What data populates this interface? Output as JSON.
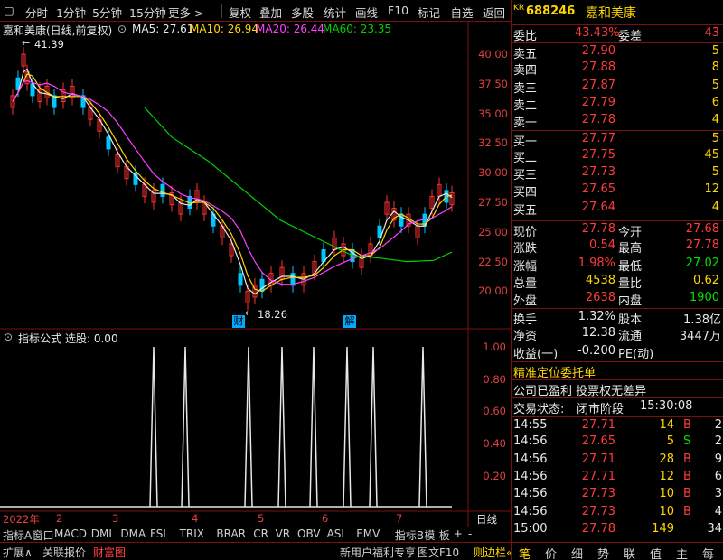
{
  "toolbar": {
    "items": [
      "分时",
      "1分钟",
      "5分钟",
      "15分钟",
      "更多 >",
      "复权",
      "叠加",
      "多股",
      "统计",
      "画线",
      "F10",
      "标记",
      "-自选",
      "返回"
    ]
  },
  "chart": {
    "title": "嘉和美康(日线,前复权)",
    "ma": [
      {
        "label": "MA5: 27.61",
        "color": "#e8e8e8"
      },
      {
        "label": "MA10: 26.94",
        "color": "#ffd700"
      },
      {
        "label": "MA20: 26.44",
        "color": "#ff40ff"
      },
      {
        "label": "MA60: 23.35",
        "color": "#00d000"
      }
    ],
    "y_ticks": [
      "40.00",
      "37.50",
      "35.00",
      "32.50",
      "30.00",
      "27.50",
      "25.00",
      "22.50",
      "20.00"
    ],
    "high_label": "41.39",
    "low_label": "18.26",
    "marker_cai": "财",
    "marker_jie": "解",
    "colors": {
      "up": "#ff3030",
      "down": "#00c8ff",
      "axis": "#7a1010"
    }
  },
  "indicator": {
    "title": "指标公式",
    "sub": "选股: 0.00",
    "y_ticks": [
      "1.00",
      "0.80",
      "0.60",
      "0.40",
      "0.20"
    ]
  },
  "time_axis": {
    "labels": [
      "2022年",
      "2",
      "3",
      "4",
      "5",
      "6",
      "7"
    ],
    "right": "日线"
  },
  "tabs1": [
    "指标A",
    "窗口",
    "MACD",
    "DMI",
    "DMA",
    "FSL",
    "TRIX",
    "BRAR",
    "CR",
    "VR",
    "OBV",
    "ASI",
    "EMV",
    "指标B",
    "模",
    "板",
    "+",
    "-"
  ],
  "tabs2": {
    "left": [
      "扩展∧",
      "关联报价",
      "财富图"
    ],
    "right": [
      "新用户福利专享",
      "图文F10",
      "则边栏«"
    ]
  },
  "quote": {
    "badge": "KR",
    "code": "688246",
    "name": "嘉和美康",
    "weibi_label": "委比",
    "weibi": "43.43%",
    "weicha_label": "委差",
    "weicha": "43",
    "asks": [
      {
        "label": "卖五",
        "price": "27.90",
        "vol": "5"
      },
      {
        "label": "卖四",
        "price": "27.88",
        "vol": "8"
      },
      {
        "label": "卖三",
        "price": "27.87",
        "vol": "5"
      },
      {
        "label": "卖二",
        "price": "27.79",
        "vol": "6"
      },
      {
        "label": "卖一",
        "price": "27.78",
        "vol": "4"
      }
    ],
    "bids": [
      {
        "label": "买一",
        "price": "27.77",
        "vol": "5"
      },
      {
        "label": "买二",
        "price": "27.75",
        "vol": "45"
      },
      {
        "label": "买三",
        "price": "27.73",
        "vol": "5"
      },
      {
        "label": "买四",
        "price": "27.65",
        "vol": "12"
      },
      {
        "label": "买五",
        "price": "27.64",
        "vol": "4"
      }
    ],
    "stats": [
      {
        "l1": "现价",
        "v1": "27.78",
        "c1": "red",
        "l2": "今开",
        "v2": "27.68",
        "c2": "red"
      },
      {
        "l1": "涨跌",
        "v1": "0.54",
        "c1": "red",
        "l2": "最高",
        "v2": "27.78",
        "c2": "red"
      },
      {
        "l1": "涨幅",
        "v1": "1.98%",
        "c1": "red",
        "l2": "最低",
        "v2": "27.02",
        "c2": "grn"
      },
      {
        "l1": "总量",
        "v1": "4538",
        "c1": "yel",
        "l2": "量比",
        "v2": "0.62",
        "c2": "yel"
      },
      {
        "l1": "外盘",
        "v1": "2638",
        "c1": "red",
        "l2": "内盘",
        "v2": "1900",
        "c2": "grn"
      }
    ],
    "stats2": [
      {
        "l1": "换手",
        "v1": "1.32%",
        "l2": "股本",
        "v2": "1.38亿"
      },
      {
        "l1": "净资",
        "v1": "12.38",
        "l2": "流通",
        "v2": "3447万"
      },
      {
        "l1": "收益(一)",
        "v1": "-0.200",
        "l2": "PE(动)",
        "v2": ""
      }
    ],
    "promo": "精准定位委托单",
    "info": "公司已盈利 投票权无差异",
    "status_label": "交易状态:",
    "status": "闭市阶段",
    "status_time": "15:30:08",
    "ticks": [
      {
        "t": "14:55",
        "p": "27.71",
        "v": "14",
        "s": "B",
        "n": "2"
      },
      {
        "t": "14:56",
        "p": "27.65",
        "v": "5",
        "s": "S",
        "n": "2"
      },
      {
        "t": "14:56",
        "p": "27.71",
        "v": "28",
        "s": "B",
        "n": "9"
      },
      {
        "t": "14:56",
        "p": "27.71",
        "v": "12",
        "s": "B",
        "n": "6"
      },
      {
        "t": "14:56",
        "p": "27.73",
        "v": "10",
        "s": "B",
        "n": "3"
      },
      {
        "t": "14:56",
        "p": "27.73",
        "v": "10",
        "s": "B",
        "n": "4"
      },
      {
        "t": "15:00",
        "p": "27.78",
        "v": "149",
        "s": "",
        "n": "34"
      }
    ],
    "bottom_tabs": [
      "笔",
      "价",
      "细",
      "势",
      "联",
      "值",
      "主",
      "每"
    ]
  }
}
